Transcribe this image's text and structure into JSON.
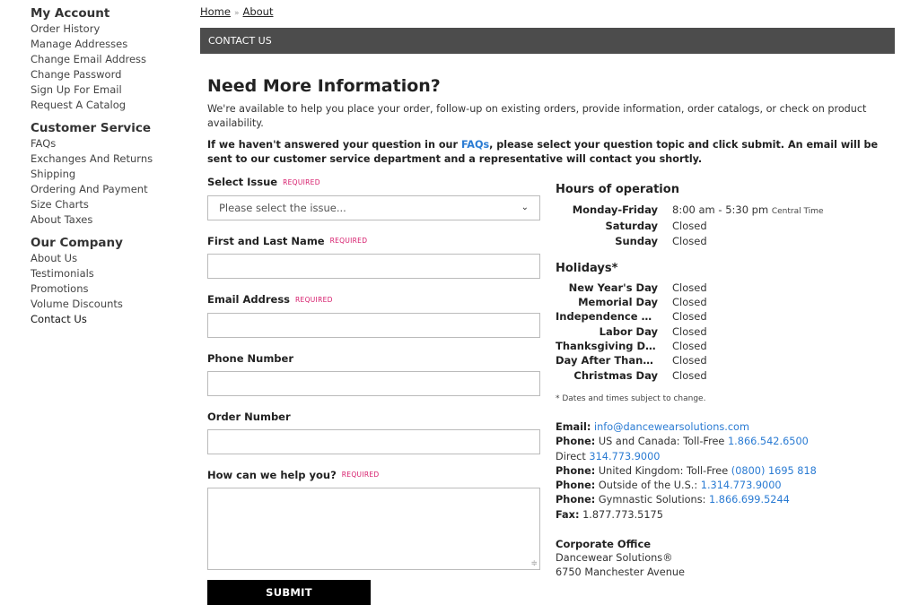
{
  "sidebar": {
    "sections": [
      {
        "heading": "My Account",
        "items": [
          "Order History",
          "Manage Addresses",
          "Change Email Address",
          "Change Password",
          "Sign Up For Email",
          "Request A Catalog"
        ]
      },
      {
        "heading": "Customer Service",
        "items": [
          "FAQs",
          "Exchanges And Returns",
          "Shipping",
          "Ordering And Payment",
          "Size Charts",
          "About Taxes"
        ]
      },
      {
        "heading": "Our Company",
        "items": [
          "About Us",
          "Testimonials",
          "Promotions",
          "Volume Discounts",
          "Contact Us"
        ]
      }
    ]
  },
  "breadcrumb": {
    "home": "Home",
    "separator": "»",
    "current": "About"
  },
  "bar_title": "CONTACT US",
  "page_title": "Need More Information?",
  "intro": "We're available to help you place your order, follow-up on existing orders, provide information, order catalogs, or check on product availability.",
  "notice": {
    "before": "If we haven't answered your question in our ",
    "link": "FAQs",
    "after": ", please select your question topic and click submit. An email will be sent to our customer service department and a representative will contact you shortly."
  },
  "form": {
    "required_text": "REQUIRED",
    "select_issue": {
      "label": "Select Issue",
      "value": "Please select the issue..."
    },
    "name": {
      "label": "First and Last Name"
    },
    "email": {
      "label": "Email Address"
    },
    "phone": {
      "label": "Phone Number"
    },
    "order": {
      "label": "Order Number"
    },
    "help": {
      "label": "How can we help you?"
    },
    "submit_label": "SUBMIT"
  },
  "hours": {
    "heading": "Hours of operation",
    "rows": [
      {
        "day": "Monday-Friday",
        "value": "8:00 am - 5:30 pm",
        "tz": "Central Time"
      },
      {
        "day": "Saturday",
        "value": "Closed"
      },
      {
        "day": "Sunday",
        "value": "Closed"
      }
    ]
  },
  "holidays": {
    "heading": "Holidays*",
    "rows": [
      {
        "day": "New Year's Day",
        "value": "Closed"
      },
      {
        "day": "Memorial Day",
        "value": "Closed"
      },
      {
        "day": "Independence Day",
        "value": "Closed"
      },
      {
        "day": "Labor Day",
        "value": "Closed"
      },
      {
        "day": "Thanksgiving Day",
        "value": "Closed"
      },
      {
        "day": "Day After Thanksgiving",
        "value": "Closed"
      },
      {
        "day": "Christmas Day",
        "value": "Closed"
      }
    ],
    "note": "* Dates and times subject to change."
  },
  "contact": {
    "email_label": "Email:",
    "email": "info@dancewearsolutions.com",
    "phone_label": "Phone:",
    "us_text": "US and Canada: Toll-Free ",
    "us_phone": "1.866.542.6500",
    "direct_text": "Direct ",
    "direct_phone": "314.773.9000",
    "uk_text": "United Kingdom: Toll-Free ",
    "uk_phone": "(0800) 1695 818",
    "outside_text": "Outside of the U.S.: ",
    "outside_phone": "1.314.773.9000",
    "gym_text": "Gymnastic Solutions: ",
    "gym_phone": "1.866.699.5244",
    "fax_label": "Fax:",
    "fax": "1.877.773.5175"
  },
  "corporate": {
    "heading": "Corporate Office",
    "name": "Dancewear Solutions®",
    "address": "6750 Manchester Avenue"
  }
}
